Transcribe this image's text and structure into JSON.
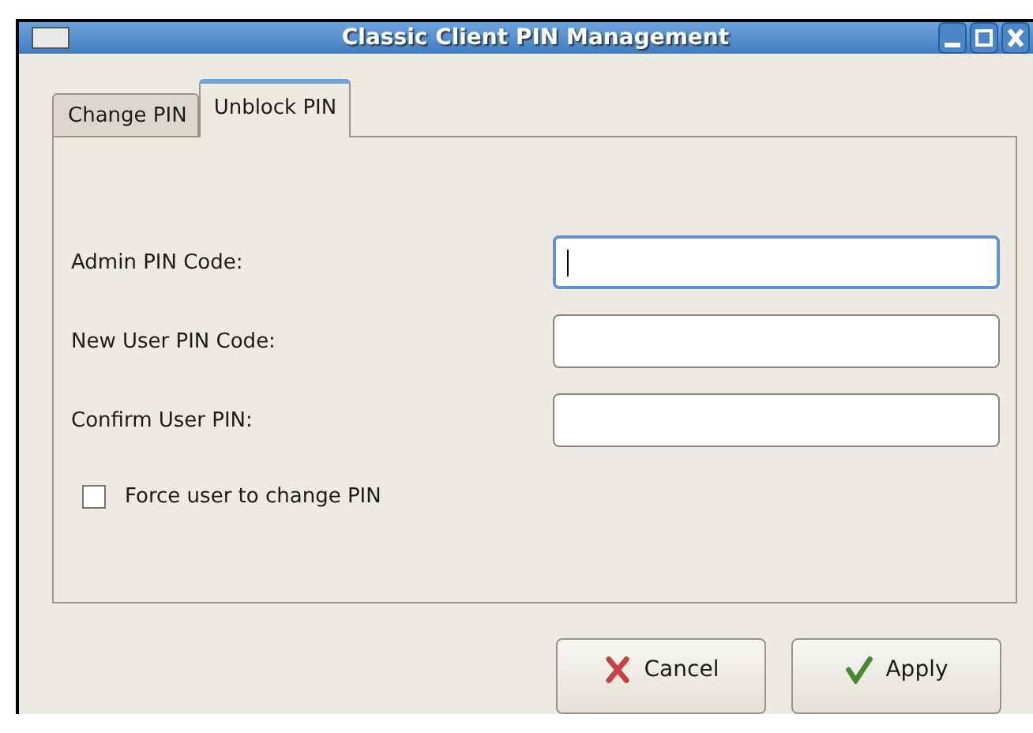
{
  "window": {
    "title": "Classic Client PIN Management"
  },
  "tabs": [
    {
      "label": "Change PIN",
      "selected": false
    },
    {
      "label": "Unblock PIN",
      "selected": true
    }
  ],
  "fields": [
    {
      "label": "Admin PIN Code:",
      "focused": true
    },
    {
      "label": "New User PIN Code:",
      "focused": false
    },
    {
      "label": "Confirm User PIN:",
      "focused": false
    }
  ],
  "checkbox": {
    "label": "Force user to change PIN",
    "checked": false
  },
  "buttons": [
    {
      "label": "Cancel",
      "kind": "cancel"
    },
    {
      "label": "Apply",
      "kind": "apply"
    }
  ]
}
